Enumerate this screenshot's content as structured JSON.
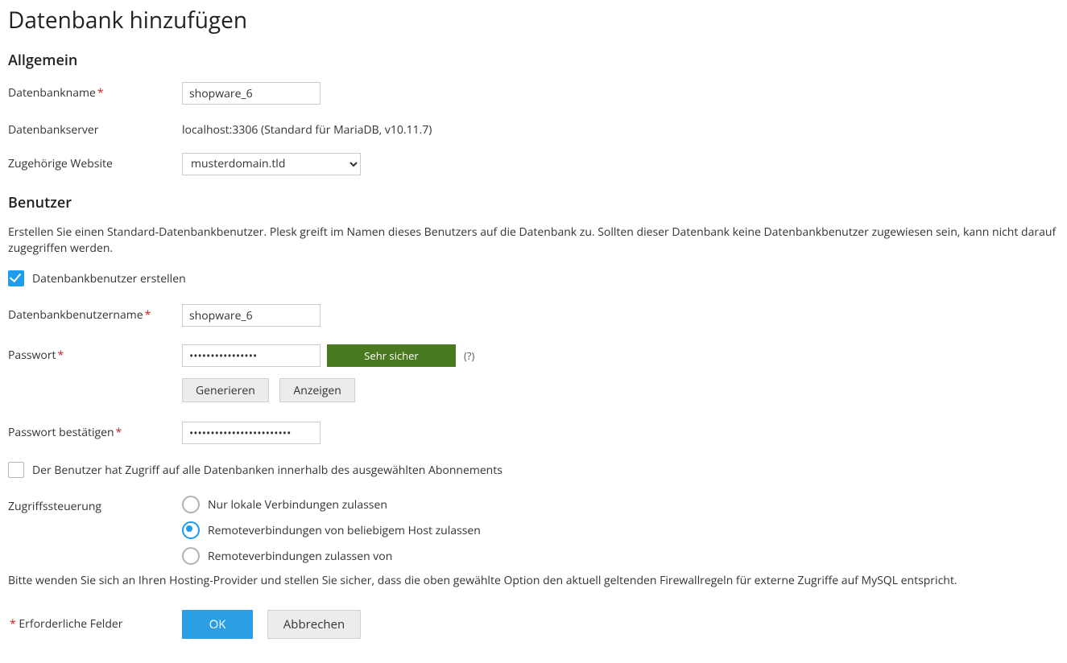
{
  "page": {
    "title": "Datenbank hinzufügen"
  },
  "sections": {
    "general_title": "Allgemein",
    "users_title": "Benutzer"
  },
  "general": {
    "db_name_label": "Datenbankname",
    "db_name_value": "shopware_6",
    "db_server_label": "Datenbankserver",
    "db_server_value": "localhost:3306 (Standard für MariaDB, v10.11.7)",
    "website_label": "Zugehörige Website",
    "website_selected": "musterdomain.tld"
  },
  "users": {
    "intro": "Erstellen Sie einen Standard-Datenbankbenutzer. Plesk greift im Namen dieses Benutzers auf die Datenbank zu. Sollten dieser Datenbank keine Datenbankbenutzer zugewiesen sein, kann nicht darauf zugegriffen werden.",
    "create_user_label": "Datenbankbenutzer erstellen",
    "create_user_checked": true,
    "username_label": "Datenbankbenutzername",
    "username_value": "shopware_6",
    "password_label": "Passwort",
    "password_value": "••••••••••••••••",
    "password_strength": "Sehr sicher",
    "hint": "(?)",
    "generate_btn": "Generieren",
    "show_btn": "Anzeigen",
    "password_confirm_label": "Passwort bestätigen",
    "password_confirm_value": "••••••••••••••••••••••••",
    "all_db_access_label": "Der Benutzer hat Zugriff auf alle Datenbanken innerhalb des ausgewählten Abonnements",
    "all_db_access_checked": false,
    "access_control_label": "Zugriffssteuerung",
    "access_options": {
      "local_only": "Nur lokale Verbindungen zulassen",
      "remote_any": "Remoteverbindungen von beliebigem Host zulassen",
      "remote_from": "Remoteverbindungen zulassen von"
    },
    "access_selected": "remote_any",
    "access_note": "Bitte wenden Sie sich an Ihren Hosting-Provider und stellen Sie sicher, dass die oben gewählte Option den aktuell geltenden Firewallregeln für externe Zugriffe auf MySQL entspricht."
  },
  "footer": {
    "required_hint": "Erforderliche Felder",
    "ok": "OK",
    "cancel": "Abbrechen"
  }
}
